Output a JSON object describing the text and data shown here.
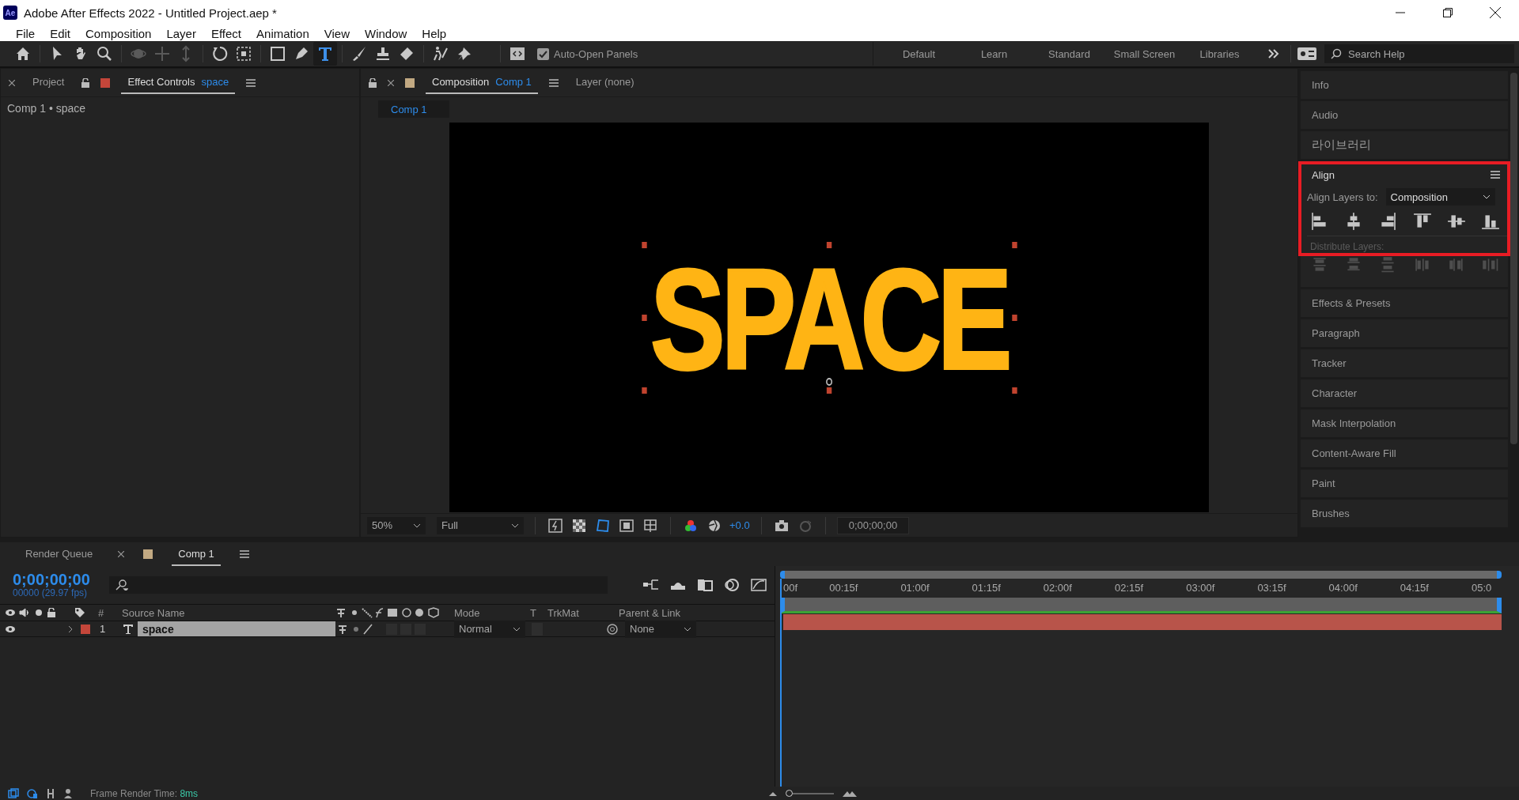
{
  "window": {
    "logo": "Ae",
    "title": "Adobe After Effects 2022 - Untitled Project.aep *"
  },
  "menu": [
    "File",
    "Edit",
    "Composition",
    "Layer",
    "Effect",
    "Animation",
    "View",
    "Window",
    "Help"
  ],
  "toolbar": {
    "tools": [
      {
        "kind": "home",
        "selected": false
      },
      {
        "kind": "arrow",
        "selected": false
      },
      {
        "kind": "hand",
        "selected": false
      },
      {
        "kind": "zoom",
        "selected": false
      },
      {
        "kind": "orbit",
        "selected": false
      },
      {
        "kind": "pan",
        "selected": false
      },
      {
        "kind": "dolly",
        "selected": false
      },
      {
        "kind": "rotate",
        "selected": false
      },
      {
        "kind": "region",
        "selected": false
      },
      {
        "kind": "rect",
        "selected": false
      },
      {
        "kind": "pen",
        "selected": false
      },
      {
        "kind": "type",
        "selected": true
      },
      {
        "kind": "brush",
        "selected": false
      },
      {
        "kind": "stamp",
        "selected": false
      },
      {
        "kind": "eraser",
        "selected": false
      },
      {
        "kind": "puppet",
        "selected": false
      },
      {
        "kind": "pin",
        "selected": false
      }
    ],
    "auto_open_panels": {
      "label": "Auto-Open Panels",
      "checked": true
    },
    "workspaces": [
      "Default",
      "Learn",
      "Standard",
      "Small Screen",
      "Libraries"
    ],
    "search": {
      "placeholder": "Search Help"
    }
  },
  "left_panel": {
    "tabs": [
      {
        "label": "Project",
        "selected": false
      },
      {
        "label": "Effect Controls",
        "layer": "space",
        "color": "#c4463a",
        "selected": true
      }
    ],
    "breadcrumb": "Comp 1 • space"
  },
  "composition": {
    "tabs": [
      {
        "label": "Composition",
        "comp": "Comp 1",
        "color": "#c2a982",
        "selected": true
      },
      {
        "label": "Layer (none)",
        "selected": false
      }
    ],
    "subtab": "Comp 1",
    "text": "SPACE",
    "zoom": "50%",
    "resolution": "Full",
    "exposure": "+0.0",
    "timecode": "0;00;00;00"
  },
  "right_panels": {
    "top": [
      "Info",
      "Audio",
      "라이브러리"
    ],
    "align": {
      "title": "Align",
      "label": "Align Layers to:",
      "target": "Composition",
      "distribute_label": "Distribute Layers:"
    },
    "bottom": [
      "Effects & Presets",
      "Paragraph",
      "Tracker",
      "Character",
      "Mask Interpolation",
      "Content-Aware Fill",
      "Paint",
      "Brushes"
    ]
  },
  "timeline": {
    "tabs": [
      {
        "label": "Render Queue",
        "selected": false
      },
      {
        "label": "Comp 1",
        "color": "#c2a982",
        "selected": true
      }
    ],
    "timecode": "0;00;00;00",
    "frame_info": "00000 (29.97 fps)",
    "columns": {
      "number": "#",
      "source": "Source Name",
      "mode": "Mode",
      "t": "T",
      "trkmat": "TrkMat",
      "parent": "Parent & Link"
    },
    "layers": [
      {
        "number": "1",
        "name": "space",
        "color": "#c4463a",
        "visible": true,
        "selected": true,
        "mode": "Normal",
        "parent": "None"
      }
    ],
    "ruler": [
      "00f",
      "00:15f",
      "01:00f",
      "01:15f",
      "02:00f",
      "02:15f",
      "03:00f",
      "03:15f",
      "04:00f",
      "04:15f",
      "05:0"
    ]
  },
  "status": {
    "label": "Frame Render Time:",
    "value": "8ms",
    "zoom_slider": {
      "level": 0.05
    }
  }
}
